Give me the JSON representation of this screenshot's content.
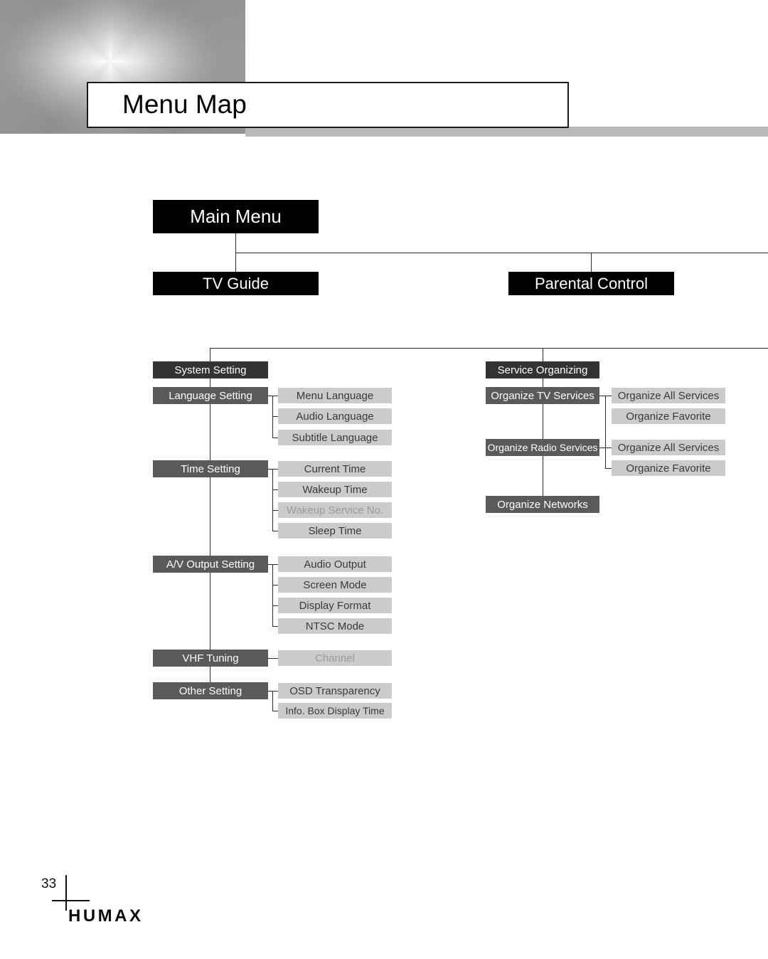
{
  "header": {
    "title": "Menu Map"
  },
  "diagram": {
    "root": {
      "label": "Main Menu"
    },
    "main_items": [
      {
        "label": "TV Guide"
      },
      {
        "label": "Parental Control"
      }
    ],
    "columns": [
      {
        "section": {
          "label": "System Setting"
        },
        "groups": [
          {
            "label": "Language Setting",
            "children": [
              {
                "label": "Menu Language",
                "disabled": false
              },
              {
                "label": "Audio Language",
                "disabled": false
              },
              {
                "label": "Subtitle Language",
                "disabled": false
              }
            ]
          },
          {
            "label": "Time Setting",
            "children": [
              {
                "label": "Current Time",
                "disabled": false
              },
              {
                "label": "Wakeup Time",
                "disabled": false
              },
              {
                "label": "Wakeup Service No.",
                "disabled": true
              },
              {
                "label": "Sleep Time",
                "disabled": false
              }
            ]
          },
          {
            "label": "A/V Output Setting",
            "children": [
              {
                "label": "Audio Output",
                "disabled": false
              },
              {
                "label": "Screen Mode",
                "disabled": false
              },
              {
                "label": "Display Format",
                "disabled": false
              },
              {
                "label": "NTSC Mode",
                "disabled": false
              }
            ]
          },
          {
            "label": "VHF Tuning",
            "children": [
              {
                "label": "Channel",
                "disabled": true
              }
            ]
          },
          {
            "label": "Other Setting",
            "children": [
              {
                "label": "OSD Transparency",
                "disabled": false
              },
              {
                "label": "Info. Box Display Time",
                "disabled": false
              }
            ]
          }
        ]
      },
      {
        "section": {
          "label": "Service Organizing"
        },
        "groups": [
          {
            "label": "Organize TV Services",
            "children": [
              {
                "label": "Organize All Services",
                "disabled": false
              },
              {
                "label": "Organize Favorite",
                "disabled": false
              }
            ]
          },
          {
            "label": "Organize Radio Services",
            "children": [
              {
                "label": "Organize All Services",
                "disabled": false
              },
              {
                "label": "Organize Favorite",
                "disabled": false
              }
            ]
          },
          {
            "label": "Organize Networks",
            "children": []
          }
        ]
      }
    ]
  },
  "footer": {
    "page_number": "33",
    "brand": "HUMAX"
  },
  "colors": {
    "root_box": "#000000",
    "section_box": "#333333",
    "group_box": "#5a5a5a",
    "leaf_box": "#cbcbcb",
    "leaf_text": "#3a3a3a",
    "leaf_text_disabled": "#9b9b9b",
    "connector": "#2b2b2b",
    "banner_strip": "#b9b9b9"
  }
}
